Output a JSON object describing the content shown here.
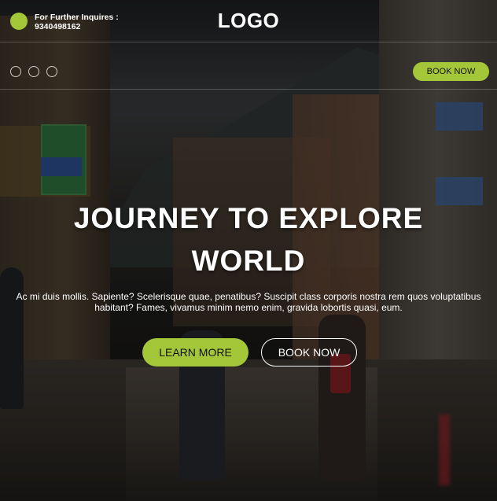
{
  "header": {
    "contact_line1": "For Further Inquires :",
    "contact_line2": "9340498162",
    "logo": "LOGO"
  },
  "subbar": {
    "slider_dots": [
      "dot-1",
      "dot-2",
      "dot-3"
    ],
    "book_now_label": "BOOK NOW"
  },
  "hero": {
    "title_line1": "JOURNEY TO EXPLORE",
    "title_line2": "WORLD",
    "description": "Ac mi duis mollis. Sapiente? Scelerisque quae, penatibus? Suscipit class corporis nostra rem quos voluptatibus habitant? Fames, vivamus minim nemo enim, gravida lobortis quasi, eum.",
    "learn_more_label": "LEARN MORE",
    "book_now_label": "BOOK NOW"
  },
  "colors": {
    "accent": "#a4c639",
    "text": "#ffffff"
  },
  "icons": {
    "contact": "phone-dot-icon",
    "slider": "circle-outline-icon"
  }
}
